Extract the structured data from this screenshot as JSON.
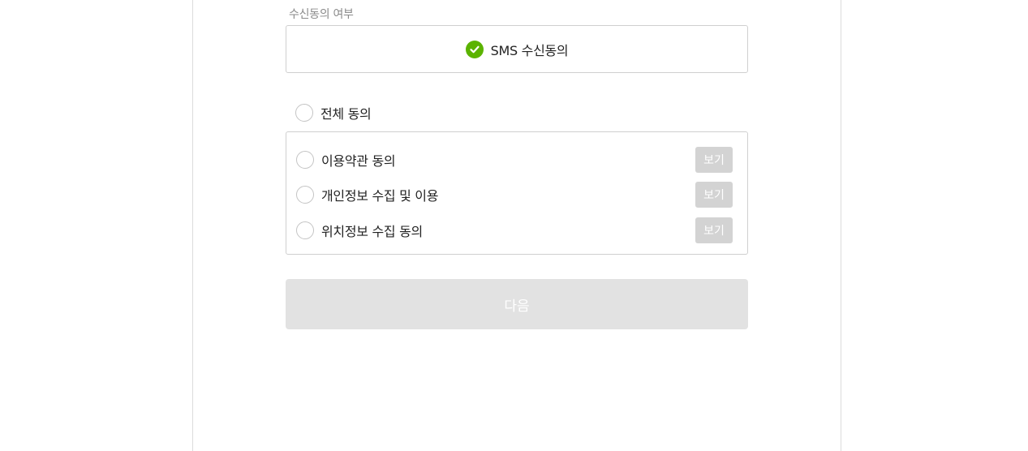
{
  "consent_section": {
    "label": "수신동의 여부",
    "sms_option": {
      "label": "SMS 수신동의",
      "checked": true,
      "check_color": "#5bb300",
      "icon": "check-icon"
    }
  },
  "agree_all": {
    "label": "전체 동의",
    "checked": false
  },
  "terms": [
    {
      "label": "이용약관 동의",
      "checked": false,
      "view_label": "보기"
    },
    {
      "label": "개인정보 수집 및 이용",
      "checked": false,
      "view_label": "보기"
    },
    {
      "label": "위치정보 수집 동의",
      "checked": false,
      "view_label": "보기"
    }
  ],
  "next_button": {
    "label": "다음",
    "enabled": false,
    "color": "#e2e2e2"
  }
}
